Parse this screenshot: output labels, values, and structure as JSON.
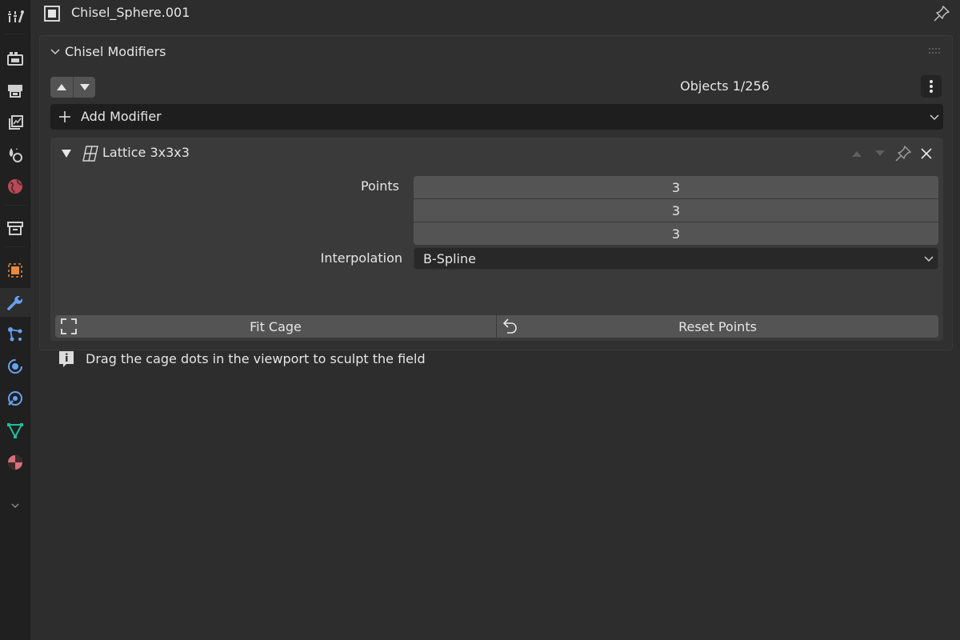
{
  "header": {
    "object_name": "Chisel_Sphere.001"
  },
  "sidebar": {
    "tabs": [
      {
        "icon": "tool-icon"
      },
      {
        "icon": "render-icon"
      },
      {
        "icon": "output-icon"
      },
      {
        "icon": "view-layer-icon"
      },
      {
        "icon": "scene-icon"
      },
      {
        "icon": "world-icon"
      },
      {
        "icon": "collection-icon"
      },
      {
        "icon": "object-icon"
      },
      {
        "icon": "modifier-icon",
        "active": true
      },
      {
        "icon": "particles-icon"
      },
      {
        "icon": "physics-icon"
      },
      {
        "icon": "constraints-icon"
      },
      {
        "icon": "data-icon"
      },
      {
        "icon": "material-icon"
      }
    ]
  },
  "panel": {
    "title": "Chisel Modifiers",
    "counter": "Objects 1/256",
    "add_modifier_label": "Add Modifier",
    "modifier": {
      "name": "Lattice 3x3x3",
      "points_label": "Points",
      "points": [
        "3",
        "3",
        "3"
      ],
      "interpolation_label": "Interpolation",
      "interpolation_value": "B-Spline",
      "fit_cage_label": "Fit Cage",
      "reset_points_label": "Reset Points",
      "info_text": "Drag the cage dots in the viewport to sculpt the field"
    }
  },
  "colors": {
    "background": "#2d2d2d",
    "sidebar": "#202020",
    "panel": "#303030",
    "modifier_box": "#3a3a3a",
    "field": "#545454",
    "dark_field": "#1e1e1e",
    "object_orange": "#e8893c",
    "modifier_blue": "#6aa0ee"
  }
}
